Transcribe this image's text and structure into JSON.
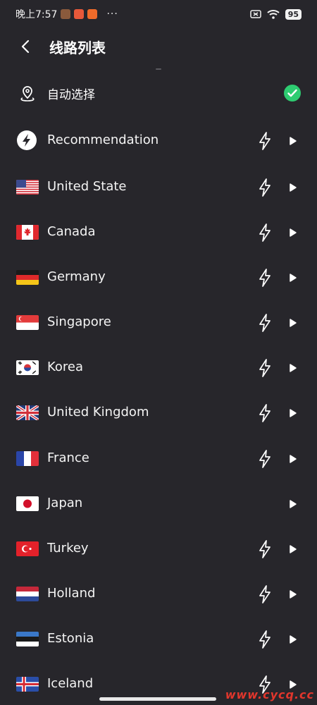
{
  "status_bar": {
    "time": "晚上7:57",
    "dots": "···",
    "battery": "95"
  },
  "header": {
    "title": "线路列表"
  },
  "auto_select": {
    "label": "自动选择",
    "selected": true
  },
  "servers": [
    {
      "label": "Recommendation",
      "icon": "recommendation-icon",
      "boost": true
    },
    {
      "label": "United State",
      "icon": "flag-us",
      "boost": true
    },
    {
      "label": "Canada",
      "icon": "flag-ca",
      "boost": true
    },
    {
      "label": "Germany",
      "icon": "flag-de",
      "boost": true
    },
    {
      "label": "Singapore",
      "icon": "flag-sg",
      "boost": true
    },
    {
      "label": "Korea",
      "icon": "flag-kr",
      "boost": true
    },
    {
      "label": "United Kingdom",
      "icon": "flag-gb",
      "boost": true
    },
    {
      "label": "France",
      "icon": "flag-fr",
      "boost": true
    },
    {
      "label": "Japan",
      "icon": "flag-jp",
      "boost": false
    },
    {
      "label": "Turkey",
      "icon": "flag-tr",
      "boost": true
    },
    {
      "label": "Holland",
      "icon": "flag-nl",
      "boost": true
    },
    {
      "label": "Estonia",
      "icon": "flag-ee",
      "boost": true
    },
    {
      "label": "Iceland",
      "icon": "flag-is",
      "boost": true
    }
  ],
  "watermark": "www.cycq.cc",
  "colors": {
    "background": "#27262b",
    "check": "#2ecc71",
    "text": "#ffffff"
  }
}
